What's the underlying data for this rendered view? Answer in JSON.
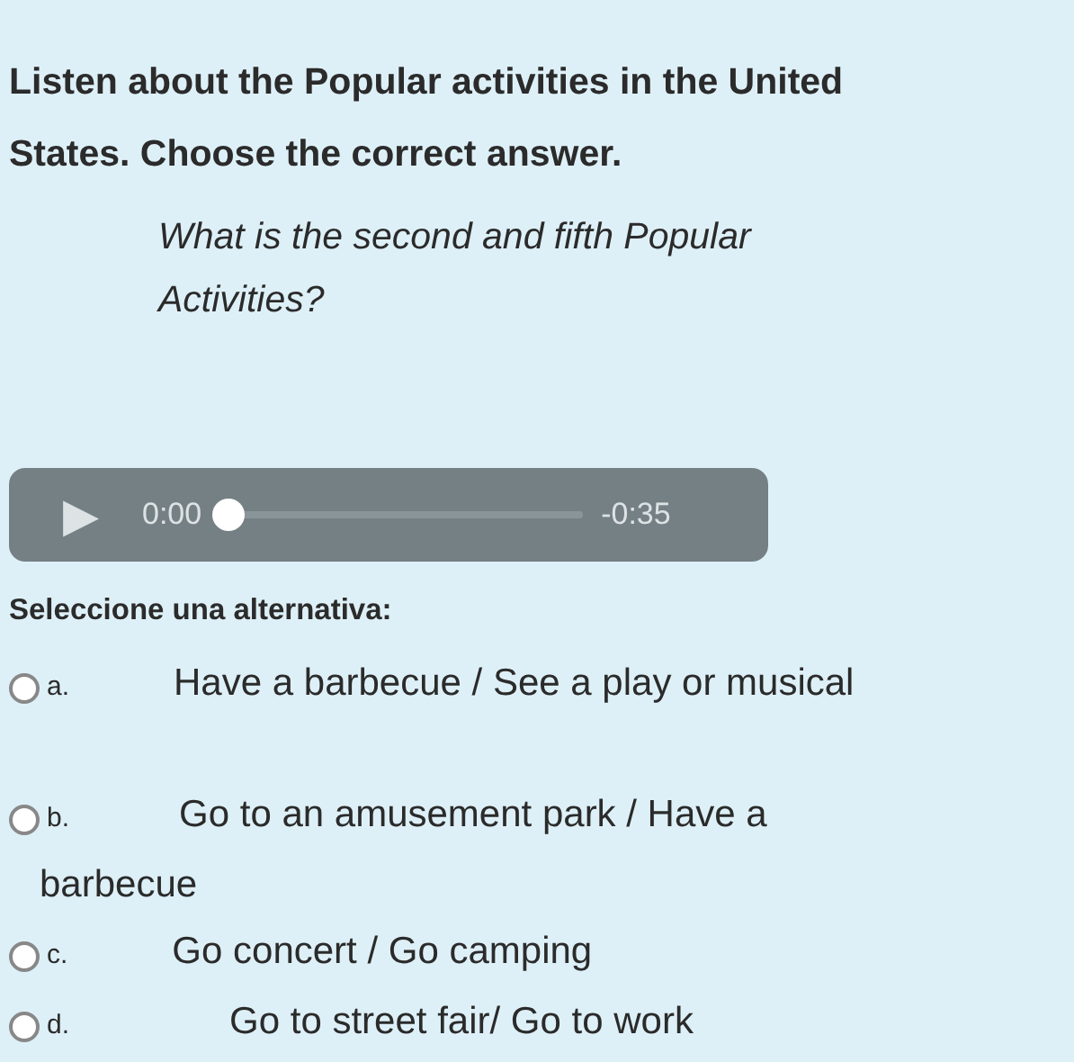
{
  "instruction": "Listen about the Popular activities in the United States. Choose the correct answer.",
  "question": "What is the second and fifth Popular Activities?",
  "audio_player": {
    "play_icon": "▶",
    "elapsed": "0:00",
    "remaining": "-0:35",
    "level": 0
  },
  "prompt": "Seleccione una alternativa:",
  "options": [
    {
      "letter": "a.",
      "text": "Have a barbecue / See a play or musical",
      "selected": false
    },
    {
      "letter": "b.",
      "text": "Go to an amusement park / Have a barbecue",
      "selected": false
    },
    {
      "letter": "c.",
      "text": "Go concert / Go camping",
      "selected": false
    },
    {
      "letter": "d.",
      "text": "Go to street fair/ Go to work",
      "selected": false
    }
  ]
}
